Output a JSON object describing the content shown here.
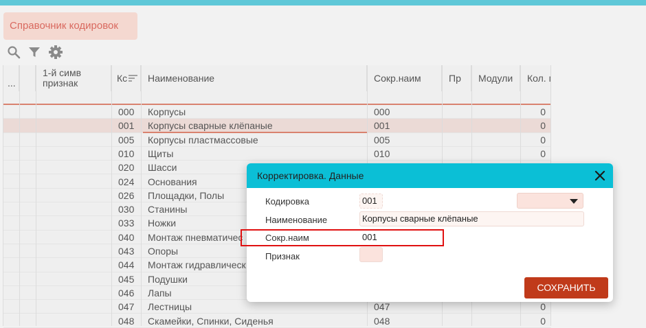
{
  "page": {
    "title_button": "Справочник кодировок"
  },
  "toolbar": {
    "icons": [
      "search-icon",
      "filter-icon",
      "settings-icon"
    ]
  },
  "grid": {
    "headers": {
      "dots": "...",
      "first_symbol": "1-й симв\nпризнак",
      "code": "Кс",
      "name": "Наименование",
      "short": "Сокр.наим",
      "pr": "Пр",
      "modules": "Модули",
      "count": "Кол. м"
    },
    "rows": [
      {
        "code": "000",
        "name": "Корпусы",
        "short": "000",
        "count": "0"
      },
      {
        "code": "001",
        "name": "Корпусы сварные клёпаные",
        "short": "001",
        "count": "0",
        "selected": true
      },
      {
        "code": "005",
        "name": "Корпусы пластмассовые",
        "short": "005",
        "count": "0"
      },
      {
        "code": "010",
        "name": "Щиты",
        "short": "010",
        "count": "0"
      },
      {
        "code": "020",
        "name": "Шасси",
        "short": "",
        "count": ""
      },
      {
        "code": "024",
        "name": "Основания",
        "short": "",
        "count": ""
      },
      {
        "code": "026",
        "name": "Площадки, Полы",
        "short": "",
        "count": ""
      },
      {
        "code": "030",
        "name": "Станины",
        "short": "",
        "count": ""
      },
      {
        "code": "033",
        "name": "Ножки",
        "short": "",
        "count": ""
      },
      {
        "code": "040",
        "name": "Монтаж пневматичес",
        "short": "",
        "count": ""
      },
      {
        "code": "043",
        "name": "Опоры",
        "short": "",
        "count": ""
      },
      {
        "code": "044",
        "name": "Монтаж гидравличеcк",
        "short": "",
        "count": ""
      },
      {
        "code": "045",
        "name": "Подушки",
        "short": "",
        "count": ""
      },
      {
        "code": "046",
        "name": "Лапы",
        "short": "",
        "count": ""
      },
      {
        "code": "047",
        "name": "Лестницы",
        "short": "047",
        "count": "0"
      },
      {
        "code": "048",
        "name": "Скамейки, Спинки, Сиденья",
        "short": "048",
        "count": "0"
      }
    ]
  },
  "modal": {
    "title": "Корректировка. Данные",
    "fields": {
      "code_label": "Кодировка",
      "code_value": "001",
      "name_label": "Наименование",
      "name_value": "Корпусы сварные клёпаные",
      "short_label": "Сокр.наим",
      "short_value": "001",
      "sign_label": "Признак",
      "sign_value": ""
    },
    "save_label": "СОХРАНИТЬ"
  }
}
